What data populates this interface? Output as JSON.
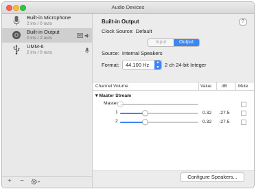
{
  "window": {
    "title": "Audio Devices"
  },
  "devices": [
    {
      "name": "Built-in Microphone",
      "io": "2 ins / 0 outs",
      "icon": "microphone-icon",
      "selected": false
    },
    {
      "name": "Built-in Output",
      "io": "0 ins / 2 outs",
      "icon": "speaker-icon",
      "selected": true,
      "badges": [
        "display-icon",
        "volume-icon"
      ]
    },
    {
      "name": "UMM-6",
      "io": "2 ins / 0 outs",
      "icon": "usb-icon",
      "selected": false,
      "badges": [
        "microphone-icon"
      ]
    }
  ],
  "sidebar_footer": {
    "add": "+",
    "remove": "−",
    "gear": "gear-icon"
  },
  "detail": {
    "title": "Built-in Output",
    "help": "?",
    "clock_label": "Clock Source:",
    "clock_value": "Default",
    "tabs": {
      "input": "Input",
      "output": "Output",
      "active": "Output"
    },
    "source_label": "Source:",
    "source_value": "Internal Speakers",
    "format_label": "Format:",
    "format_rate": "44,100 Hz",
    "format_desc": "2 ch 24-bit Integer"
  },
  "table": {
    "headers": {
      "channel": "Channel Volume",
      "value": "Value",
      "db": "dB",
      "mute": "Mute"
    },
    "group": "Master Stream",
    "rows": [
      {
        "label": "Master",
        "level": 0.0,
        "value": "",
        "db": "",
        "enabled": false
      },
      {
        "label": "1",
        "level": 0.32,
        "value": "0.32",
        "db": "-27.5",
        "enabled": true
      },
      {
        "label": "2",
        "level": 0.32,
        "value": "0.32",
        "db": "-27.5",
        "enabled": true
      }
    ]
  },
  "configure_button": "Configure Speakers...",
  "colors": {
    "accent": "#3b86f7",
    "selection": "#cfcfcf"
  }
}
